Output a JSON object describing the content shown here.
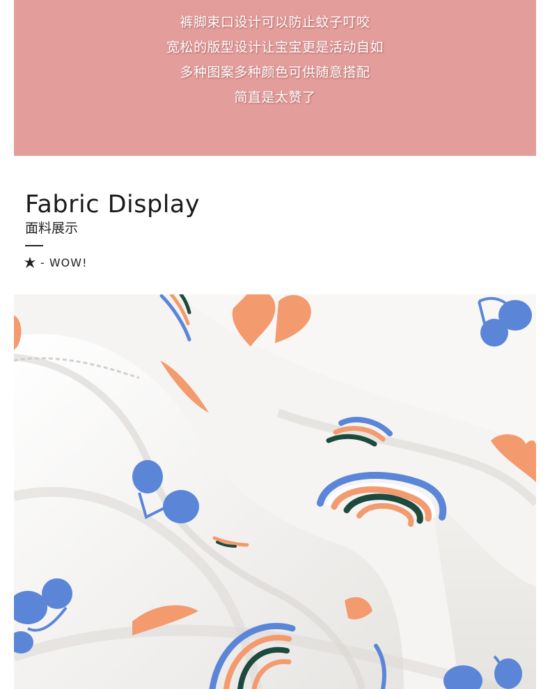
{
  "banner": {
    "lines": [
      "裤脚束口设计可以防止蚊子叮咬",
      "宽松的版型设计让宝宝更是活动自如",
      "多种图案多种颜色可供随意搭配",
      "简直是太赞了"
    ],
    "color": "#e39d9a"
  },
  "section": {
    "title_en": "Fabric Display",
    "title_zh": "面料展示",
    "tagline": "- WOW!",
    "star_icon": "star-icon"
  },
  "fabric": {
    "icons": [
      "cherry-icon",
      "heart-icon",
      "rainbow-icon"
    ],
    "colors": {
      "base": "#f7f6f4",
      "orange": "#f39a6f",
      "blue": "#5b86d8",
      "green": "#1d4a3c"
    }
  }
}
